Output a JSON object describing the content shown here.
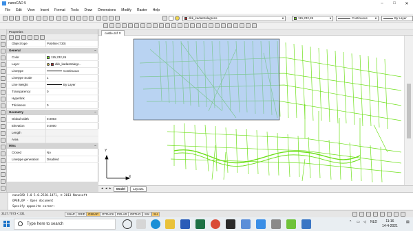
{
  "window": {
    "title": "nanoCAD 5"
  },
  "menu": [
    "File",
    "Edit",
    "View",
    "Insert",
    "Format",
    "Tools",
    "Draw",
    "Dimensions",
    "Modify",
    "Raster",
    "Help"
  ],
  "toolbar": {
    "layer_dropdown": "dkk_kadastralegrens",
    "color_dropdown": "115,232,26",
    "linetype_dropdown": "Continuous",
    "lineweight_dropdown": "By Layer",
    "accent_color": "#73e81a"
  },
  "properties": {
    "header": "Properties",
    "object_type_label": "Object type",
    "object_type_value": "Polyline (730)",
    "sections": {
      "general": "General",
      "geometry": "Geometry",
      "misc": "Misc"
    },
    "general_rows": [
      {
        "label": "Color",
        "value": "115,232,26"
      },
      {
        "label": "Layer",
        "value": "dkk_kadastralegr..."
      },
      {
        "label": "Linetype",
        "value": "Continuous"
      },
      {
        "label": "Linetype Scale",
        "value": "1"
      },
      {
        "label": "Line Weight",
        "value": "By Layer"
      },
      {
        "label": "Transparency",
        "value": "0"
      },
      {
        "label": "Hyperlink",
        "value": ""
      },
      {
        "label": "Thickness",
        "value": "0"
      }
    ],
    "geometry_rows": [
      {
        "label": "Global width",
        "value": "0.0003"
      },
      {
        "label": "Elevation",
        "value": "0.0000"
      },
      {
        "label": "Length",
        "value": ""
      },
      {
        "label": "Area",
        "value": ""
      }
    ],
    "misc_rows": [
      {
        "label": "Closed",
        "value": "No"
      },
      {
        "label": "Linetype generation",
        "value": "Disabled"
      }
    ]
  },
  "drawing": {
    "doc_tab": "castle.dxf",
    "layout_tabs": [
      "Model",
      "Layout1"
    ],
    "active_layout": "Layout1",
    "ucs_x": "X",
    "ucs_y": "Y"
  },
  "command": {
    "lines": [
      "nanoCAD 5.0 5.0.2520.1471, © 2013 Nanosoft",
      "OPEN,OP - Open document",
      "Specify opposite corner:"
    ]
  },
  "status": {
    "coords": "3127.7073 < 331",
    "buttons": [
      "SNAP",
      "GRID",
      "OSNAP",
      "OTRACK",
      "POLAR",
      "ORTHO",
      "SW",
      "SH"
    ],
    "active_buttons": [
      "OSNAP",
      "SH"
    ]
  },
  "taskbar": {
    "search_placeholder": "Type here to search",
    "language": "NLD",
    "time": "11:16",
    "date": "14-4-2021"
  }
}
